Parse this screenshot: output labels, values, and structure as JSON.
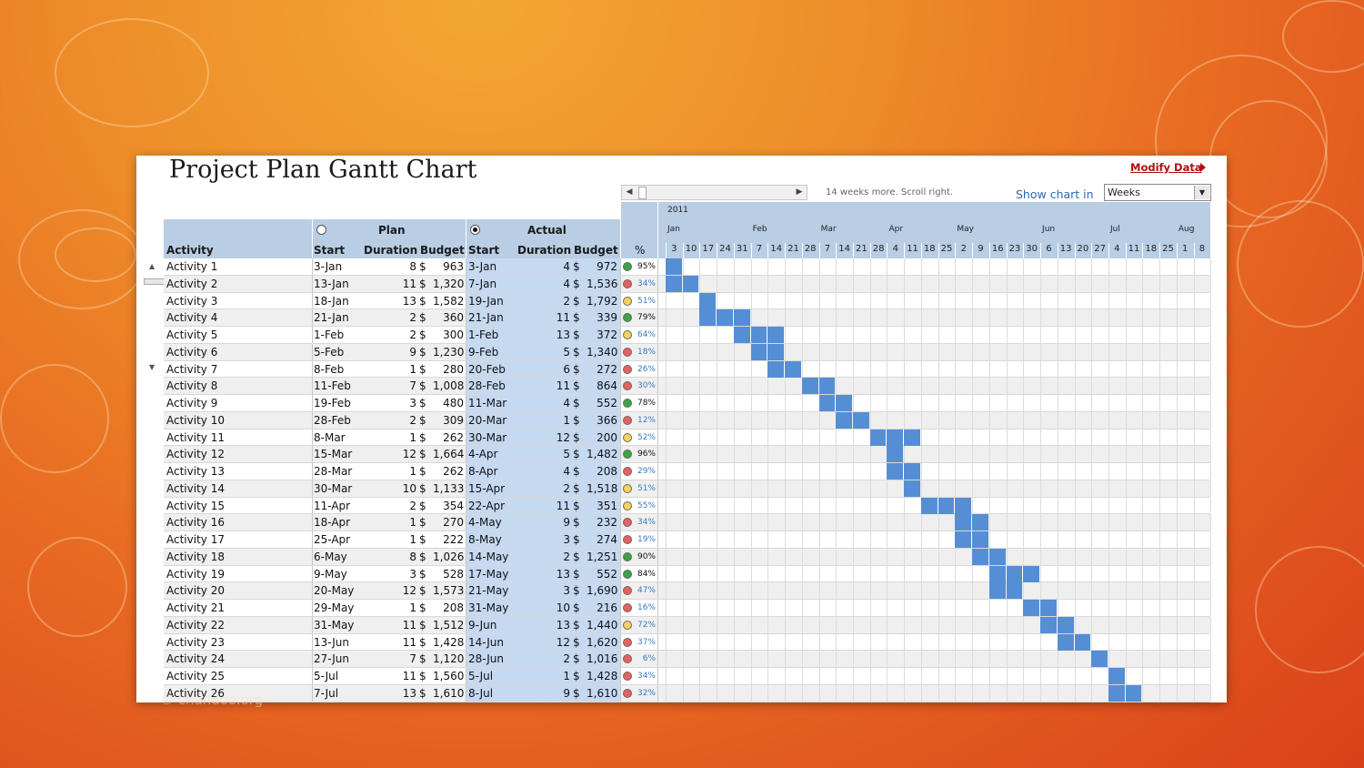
{
  "title": "Project Plan Gantt Chart",
  "modify_link": "Modify Data",
  "scroll_note": "14 weeks more. Scroll right.",
  "show_chart_label": "Show chart in",
  "unit_select": "Weeks",
  "header": {
    "activity": "Activity",
    "plan": "Plan",
    "actual": "Actual",
    "start": "Start",
    "duration": "Duration",
    "budget": "Budget",
    "pct": "%"
  },
  "year": "2011",
  "months": [
    "Jan",
    "Feb",
    "Mar",
    "Apr",
    "May",
    "Jun",
    "Jul",
    "Aug"
  ],
  "weeks": [
    "3",
    "10",
    "17",
    "24",
    "31",
    "7",
    "14",
    "21",
    "28",
    "7",
    "14",
    "21",
    "28",
    "4",
    "11",
    "18",
    "25",
    "2",
    "9",
    "16",
    "23",
    "30",
    "6",
    "13",
    "20",
    "27",
    "4",
    "11",
    "18",
    "25",
    "1",
    "8"
  ],
  "colors": {
    "bar": "#558ed5",
    "green": "#3aa544",
    "yellow": "#f6d25a",
    "red": "#e86060",
    "header": "#b9cde5"
  },
  "activities": [
    {
      "name": "Activity 1",
      "ps": "3-Jan",
      "pd": "8",
      "cur": "$",
      "pb": "963",
      "as": "3-Jan",
      "ad": "4",
      "acur": "$",
      "ab": "972",
      "status": "green",
      "pct": "95%",
      "bars": [
        0
      ]
    },
    {
      "name": "Activity 2",
      "ps": "13-Jan",
      "pd": "11",
      "cur": "$",
      "pb": "1,320",
      "as": "7-Jan",
      "ad": "4",
      "acur": "$",
      "ab": "1,536",
      "status": "red",
      "pct": "34%",
      "bars": [
        0,
        1
      ]
    },
    {
      "name": "Activity 3",
      "ps": "18-Jan",
      "pd": "13",
      "cur": "$",
      "pb": "1,582",
      "as": "19-Jan",
      "ad": "2",
      "acur": "$",
      "ab": "1,792",
      "status": "yellow",
      "pct": "51%",
      "bars": [
        2
      ]
    },
    {
      "name": "Activity 4",
      "ps": "21-Jan",
      "pd": "2",
      "cur": "$",
      "pb": "360",
      "as": "21-Jan",
      "ad": "11",
      "acur": "$",
      "ab": "339",
      "status": "green",
      "pct": "79%",
      "bars": [
        2,
        3,
        4
      ]
    },
    {
      "name": "Activity 5",
      "ps": "1-Feb",
      "pd": "2",
      "cur": "$",
      "pb": "300",
      "as": "1-Feb",
      "ad": "13",
      "acur": "$",
      "ab": "372",
      "status": "yellow",
      "pct": "64%",
      "bars": [
        4,
        5,
        6
      ]
    },
    {
      "name": "Activity 6",
      "ps": "5-Feb",
      "pd": "9",
      "cur": "$",
      "pb": "1,230",
      "as": "9-Feb",
      "ad": "5",
      "acur": "$",
      "ab": "1,340",
      "status": "red",
      "pct": "18%",
      "bars": [
        5,
        6
      ]
    },
    {
      "name": "Activity 7",
      "ps": "8-Feb",
      "pd": "1",
      "cur": "$",
      "pb": "280",
      "as": "20-Feb",
      "ad": "6",
      "acur": "$",
      "ab": "272",
      "status": "red",
      "pct": "26%",
      "bars": [
        6,
        7
      ]
    },
    {
      "name": "Activity 8",
      "ps": "11-Feb",
      "pd": "7",
      "cur": "$",
      "pb": "1,008",
      "as": "28-Feb",
      "ad": "11",
      "acur": "$",
      "ab": "864",
      "status": "red",
      "pct": "30%",
      "bars": [
        8,
        9
      ]
    },
    {
      "name": "Activity 9",
      "ps": "19-Feb",
      "pd": "3",
      "cur": "$",
      "pb": "480",
      "as": "11-Mar",
      "ad": "4",
      "acur": "$",
      "ab": "552",
      "status": "green",
      "pct": "78%",
      "bars": [
        9,
        10
      ]
    },
    {
      "name": "Activity 10",
      "ps": "28-Feb",
      "pd": "2",
      "cur": "$",
      "pb": "309",
      "as": "20-Mar",
      "ad": "1",
      "acur": "$",
      "ab": "366",
      "status": "red",
      "pct": "12%",
      "bars": [
        10,
        11
      ]
    },
    {
      "name": "Activity 11",
      "ps": "8-Mar",
      "pd": "1",
      "cur": "$",
      "pb": "262",
      "as": "30-Mar",
      "ad": "12",
      "acur": "$",
      "ab": "200",
      "status": "yellow",
      "pct": "52%",
      "bars": [
        12,
        13,
        14
      ]
    },
    {
      "name": "Activity 12",
      "ps": "15-Mar",
      "pd": "12",
      "cur": "$",
      "pb": "1,664",
      "as": "4-Apr",
      "ad": "5",
      "acur": "$",
      "ab": "1,482",
      "status": "green",
      "pct": "96%",
      "bars": [
        13
      ]
    },
    {
      "name": "Activity 13",
      "ps": "28-Mar",
      "pd": "1",
      "cur": "$",
      "pb": "262",
      "as": "8-Apr",
      "ad": "4",
      "acur": "$",
      "ab": "208",
      "status": "red",
      "pct": "29%",
      "bars": [
        13,
        14
      ]
    },
    {
      "name": "Activity 14",
      "ps": "30-Mar",
      "pd": "10",
      "cur": "$",
      "pb": "1,133",
      "as": "15-Apr",
      "ad": "2",
      "acur": "$",
      "ab": "1,518",
      "status": "yellow",
      "pct": "51%",
      "bars": [
        14
      ]
    },
    {
      "name": "Activity 15",
      "ps": "11-Apr",
      "pd": "2",
      "cur": "$",
      "pb": "354",
      "as": "22-Apr",
      "ad": "11",
      "acur": "$",
      "ab": "351",
      "status": "yellow",
      "pct": "55%",
      "bars": [
        15,
        16,
        17
      ]
    },
    {
      "name": "Activity 16",
      "ps": "18-Apr",
      "pd": "1",
      "cur": "$",
      "pb": "270",
      "as": "4-May",
      "ad": "9",
      "acur": "$",
      "ab": "232",
      "status": "red",
      "pct": "34%",
      "bars": [
        17,
        18
      ]
    },
    {
      "name": "Activity 17",
      "ps": "25-Apr",
      "pd": "1",
      "cur": "$",
      "pb": "222",
      "as": "8-May",
      "ad": "3",
      "acur": "$",
      "ab": "274",
      "status": "red",
      "pct": "19%",
      "bars": [
        17,
        18
      ]
    },
    {
      "name": "Activity 18",
      "ps": "6-May",
      "pd": "8",
      "cur": "$",
      "pb": "1,026",
      "as": "14-May",
      "ad": "2",
      "acur": "$",
      "ab": "1,251",
      "status": "green",
      "pct": "90%",
      "bars": [
        18,
        19
      ]
    },
    {
      "name": "Activity 19",
      "ps": "9-May",
      "pd": "3",
      "cur": "$",
      "pb": "528",
      "as": "17-May",
      "ad": "13",
      "acur": "$",
      "ab": "552",
      "status": "green",
      "pct": "84%",
      "bars": [
        19,
        20,
        21
      ]
    },
    {
      "name": "Activity 20",
      "ps": "20-May",
      "pd": "12",
      "cur": "$",
      "pb": "1,573",
      "as": "21-May",
      "ad": "3",
      "acur": "$",
      "ab": "1,690",
      "status": "red",
      "pct": "47%",
      "bars": [
        19,
        20
      ]
    },
    {
      "name": "Activity 21",
      "ps": "29-May",
      "pd": "1",
      "cur": "$",
      "pb": "208",
      "as": "31-May",
      "ad": "10",
      "acur": "$",
      "ab": "216",
      "status": "red",
      "pct": "16%",
      "bars": [
        21,
        22
      ]
    },
    {
      "name": "Activity 22",
      "ps": "31-May",
      "pd": "11",
      "cur": "$",
      "pb": "1,512",
      "as": "9-Jun",
      "ad": "13",
      "acur": "$",
      "ab": "1,440",
      "status": "yellow",
      "pct": "72%",
      "bars": [
        22,
        23
      ]
    },
    {
      "name": "Activity 23",
      "ps": "13-Jun",
      "pd": "11",
      "cur": "$",
      "pb": "1,428",
      "as": "14-Jun",
      "ad": "12",
      "acur": "$",
      "ab": "1,620",
      "status": "red",
      "pct": "37%",
      "bars": [
        23,
        24
      ]
    },
    {
      "name": "Activity 24",
      "ps": "27-Jun",
      "pd": "7",
      "cur": "$",
      "pb": "1,120",
      "as": "28-Jun",
      "ad": "2",
      "acur": "$",
      "ab": "1,016",
      "status": "red",
      "pct": "6%",
      "bars": [
        25
      ]
    },
    {
      "name": "Activity 25",
      "ps": "5-Jul",
      "pd": "11",
      "cur": "$",
      "pb": "1,560",
      "as": "5-Jul",
      "ad": "1",
      "acur": "$",
      "ab": "1,428",
      "status": "red",
      "pct": "34%",
      "bars": [
        26
      ]
    },
    {
      "name": "Activity 26",
      "ps": "7-Jul",
      "pd": "13",
      "cur": "$",
      "pb": "1,610",
      "as": "8-Jul",
      "ad": "9",
      "acur": "$",
      "ab": "1,610",
      "status": "red",
      "pct": "32%",
      "bars": [
        26,
        27
      ]
    }
  ]
}
